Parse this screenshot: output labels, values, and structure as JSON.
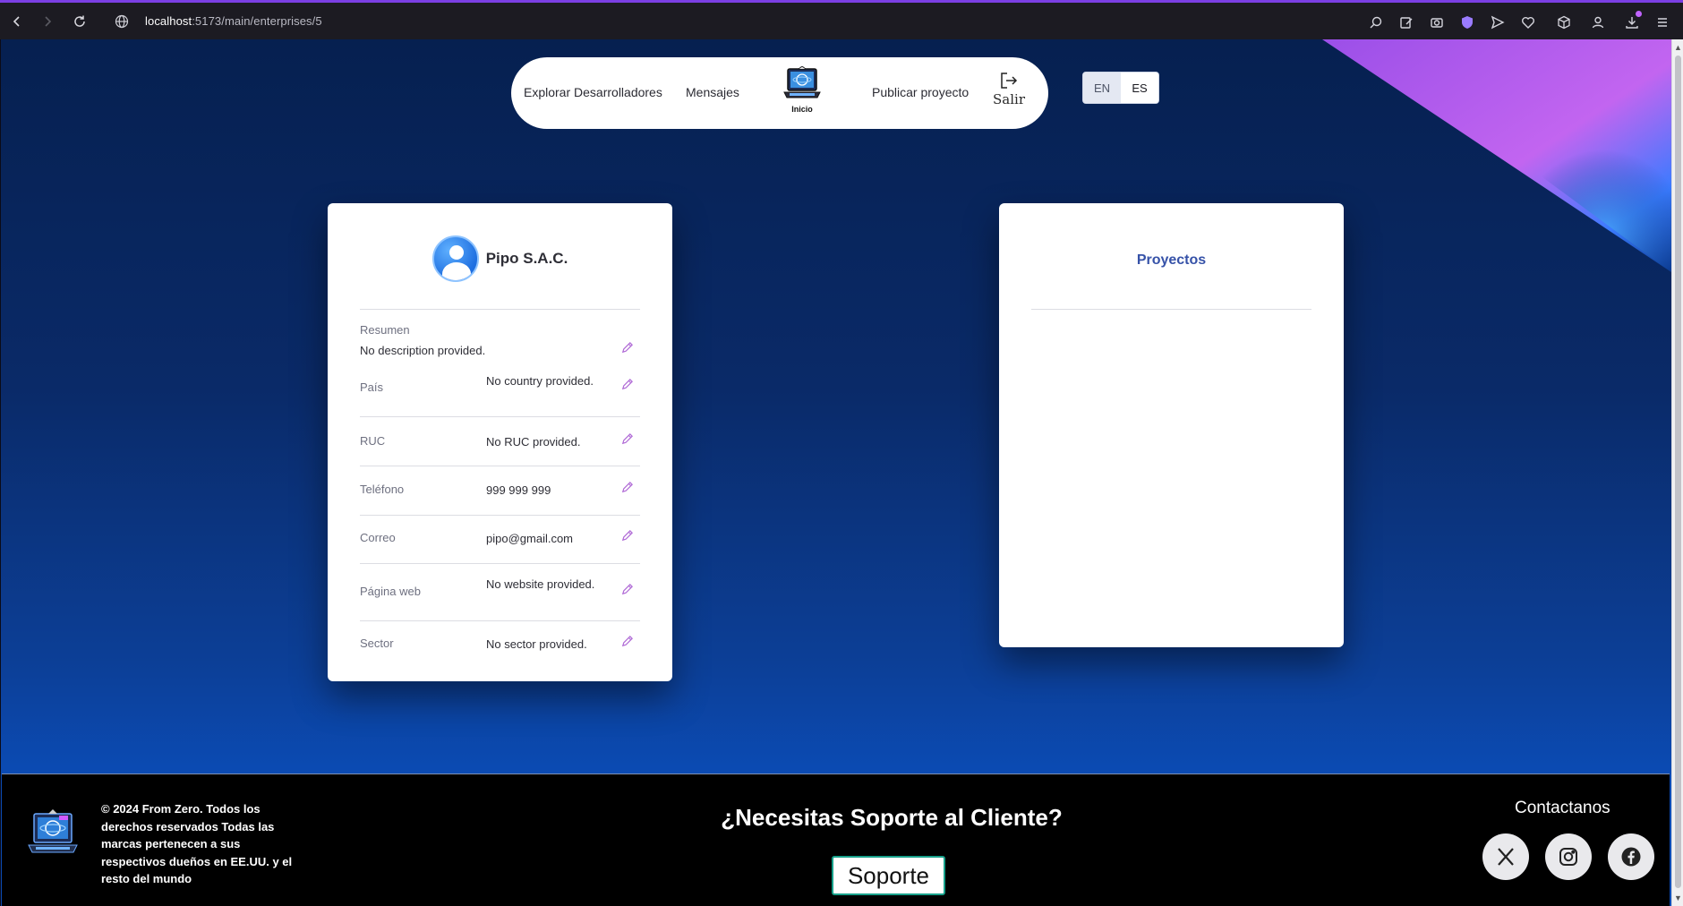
{
  "browser": {
    "url_host": "localhost",
    "url_path": ":5173/main/enterprises/5"
  },
  "nav": {
    "explore_label": "Explorar Desarrolladores",
    "messages_label": "Mensajes",
    "home_label": "Inicio",
    "publish_label": "Publicar proyecto",
    "logout_label": "Salir"
  },
  "lang": {
    "en_label": "EN",
    "es_label": "ES",
    "active": "ES"
  },
  "profile": {
    "company_name": "Pipo S.A.C.",
    "summary_label": "Resumen",
    "summary_value": "No description provided.",
    "fields": [
      {
        "label": "País",
        "value": "No country provided."
      },
      {
        "label": "RUC",
        "value": "No RUC provided."
      },
      {
        "label": "Teléfono",
        "value": "999 999 999"
      },
      {
        "label": "Correo",
        "value": "pipo@gmail.com"
      },
      {
        "label": "Página web",
        "value": "No website provided."
      },
      {
        "label": "Sector",
        "value": "No sector provided."
      }
    ]
  },
  "projects": {
    "title": "Proyectos"
  },
  "footer": {
    "copyright": "© 2024 From Zero. Todos los derechos reservados Todas las marcas pertenecen a sus respectivos dueños en EE.UU. y el resto del mundo",
    "support_title": "¿Necesitas Soporte al Cliente?",
    "support_button": "Soporte",
    "contact_title": "Contactanos"
  },
  "colors": {
    "accent_edit": "#b06ad6",
    "projects_title": "#3652a8",
    "support_border": "#17a08a"
  },
  "icons": [
    "back-icon",
    "forward-icon",
    "reload-icon",
    "globe-icon",
    "edit-icon",
    "logout-icon",
    "x-icon",
    "instagram-icon",
    "facebook-icon"
  ]
}
